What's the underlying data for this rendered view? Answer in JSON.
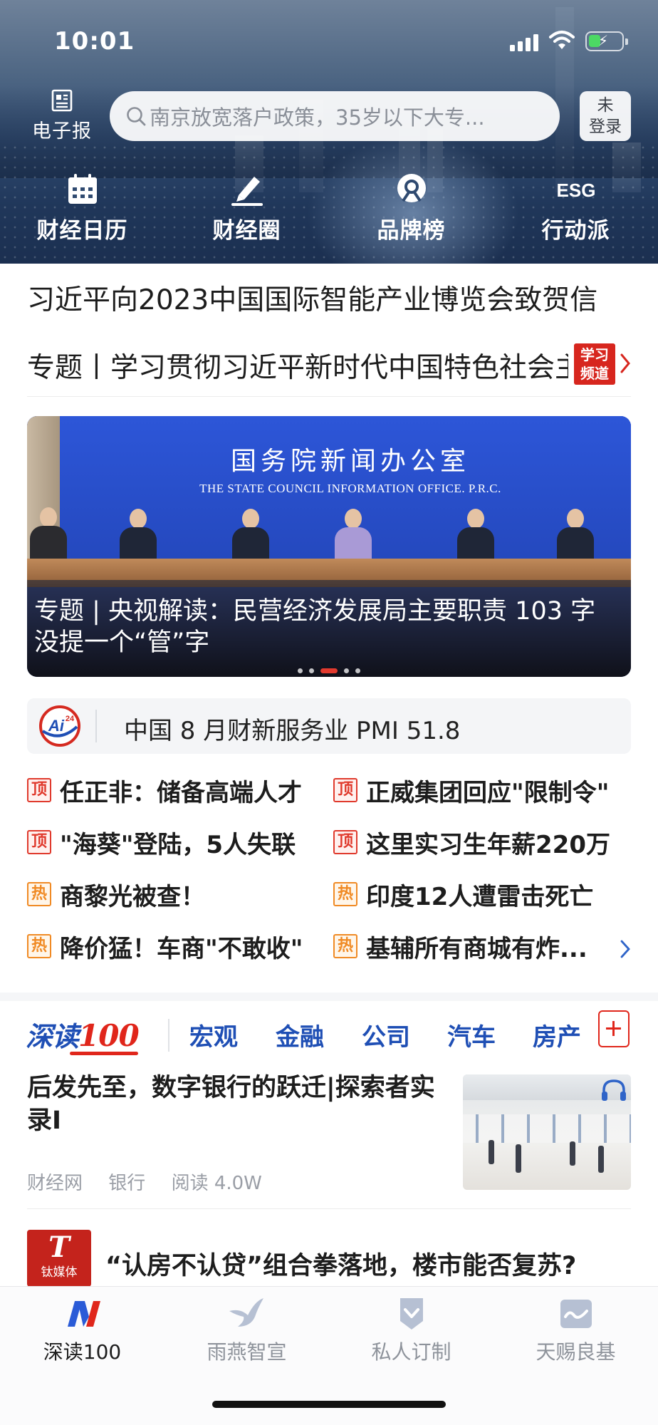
{
  "status": {
    "time": "10:01"
  },
  "header": {
    "epaper_label": "电子报",
    "search_placeholder": "南京放宽落户政策，35岁以下大专...",
    "login_label_line1": "未",
    "login_label_line2": "登录",
    "quick_links": [
      {
        "label": "财经日历",
        "icon": "calendar-icon"
      },
      {
        "label": "财经圈",
        "icon": "pen-icon"
      },
      {
        "label": "品牌榜",
        "icon": "brand-badge-icon"
      },
      {
        "label": "行动派",
        "icon": "esg-icon"
      }
    ]
  },
  "headlines": {
    "top": "习近平向2023中国国际智能产业博览会致贺信",
    "topic": "专题丨学习贯彻习近平新时代中国特色社会主义思想",
    "study_badge_line1": "学习",
    "study_badge_line2": "频道"
  },
  "banner": {
    "org_cn": "国务院新闻办公室",
    "org_en": "THE STATE COUNCIL INFORMATION OFFICE. P.R.C.",
    "caption": "专题 | 央视解读：民营经济发展局主要职责 103 字 没提一个“管”字",
    "pages": 5,
    "active_page": 3
  },
  "ai_news": {
    "badge": "Ai",
    "badge_sup": "24",
    "text": "中国 8 月财新服务业 PMI 51.8"
  },
  "hot_list": {
    "top_tag": "顶",
    "hot_tag": "热",
    "items": [
      {
        "tag": "top",
        "text": "任正非：储备高端人才"
      },
      {
        "tag": "top",
        "text": "正威集团回应\"限制令\""
      },
      {
        "tag": "top",
        "text": "\"海葵\"登陆，5人失联"
      },
      {
        "tag": "top",
        "text": "这里实习生年薪220万"
      },
      {
        "tag": "hot",
        "text": "商黎光被查！"
      },
      {
        "tag": "hot",
        "text": "印度12人遭雷击死亡"
      },
      {
        "tag": "hot",
        "text": "降价猛！车商\"不敢收\""
      },
      {
        "tag": "hot",
        "text": "基辅所有商城有炸..."
      }
    ]
  },
  "channels": {
    "brand_text": "深读",
    "brand_num": "100",
    "tabs": [
      "宏观",
      "金融",
      "公司",
      "汽车",
      "房产"
    ]
  },
  "articles": [
    {
      "title": "后发先至，数字银行的跃迁|探索者实录Ⅰ",
      "source": "财经网",
      "category": "银行",
      "reads": "阅读 4.0W"
    },
    {
      "logo_big": "T",
      "logo_small": "钛媒体",
      "title": "“认房不认贷”组合拳落地，楼市能否复苏?"
    }
  ],
  "bottom_nav": [
    {
      "label": "深读100",
      "active": true
    },
    {
      "label": "雨燕智宣",
      "active": false
    },
    {
      "label": "私人订制",
      "active": false
    },
    {
      "label": "天赐良基",
      "active": false
    }
  ],
  "colors": {
    "brand_blue": "#1f4fb5",
    "accent_red": "#e0261b",
    "hot_orange": "#f08a24"
  }
}
